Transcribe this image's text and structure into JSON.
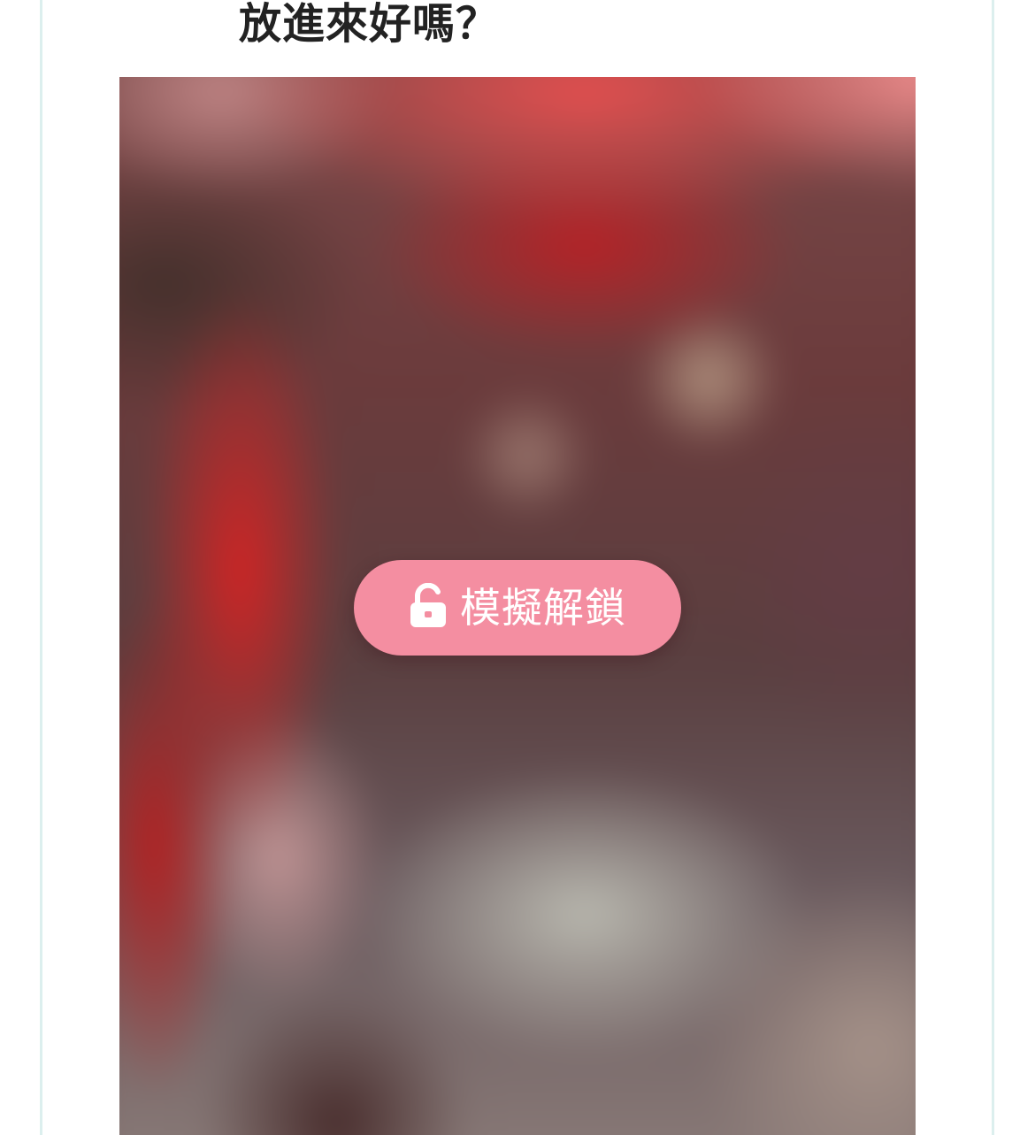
{
  "post": {
    "title": "放進來好嗎？"
  },
  "image": {
    "description_icon": "blurred-image"
  },
  "unlock": {
    "label": "模擬解鎖",
    "icon": "unlock-icon",
    "color": "#f48ea1"
  },
  "colors": {
    "card_border": "#dcefee",
    "title_text": "#222222",
    "button_text": "#ffffff"
  }
}
